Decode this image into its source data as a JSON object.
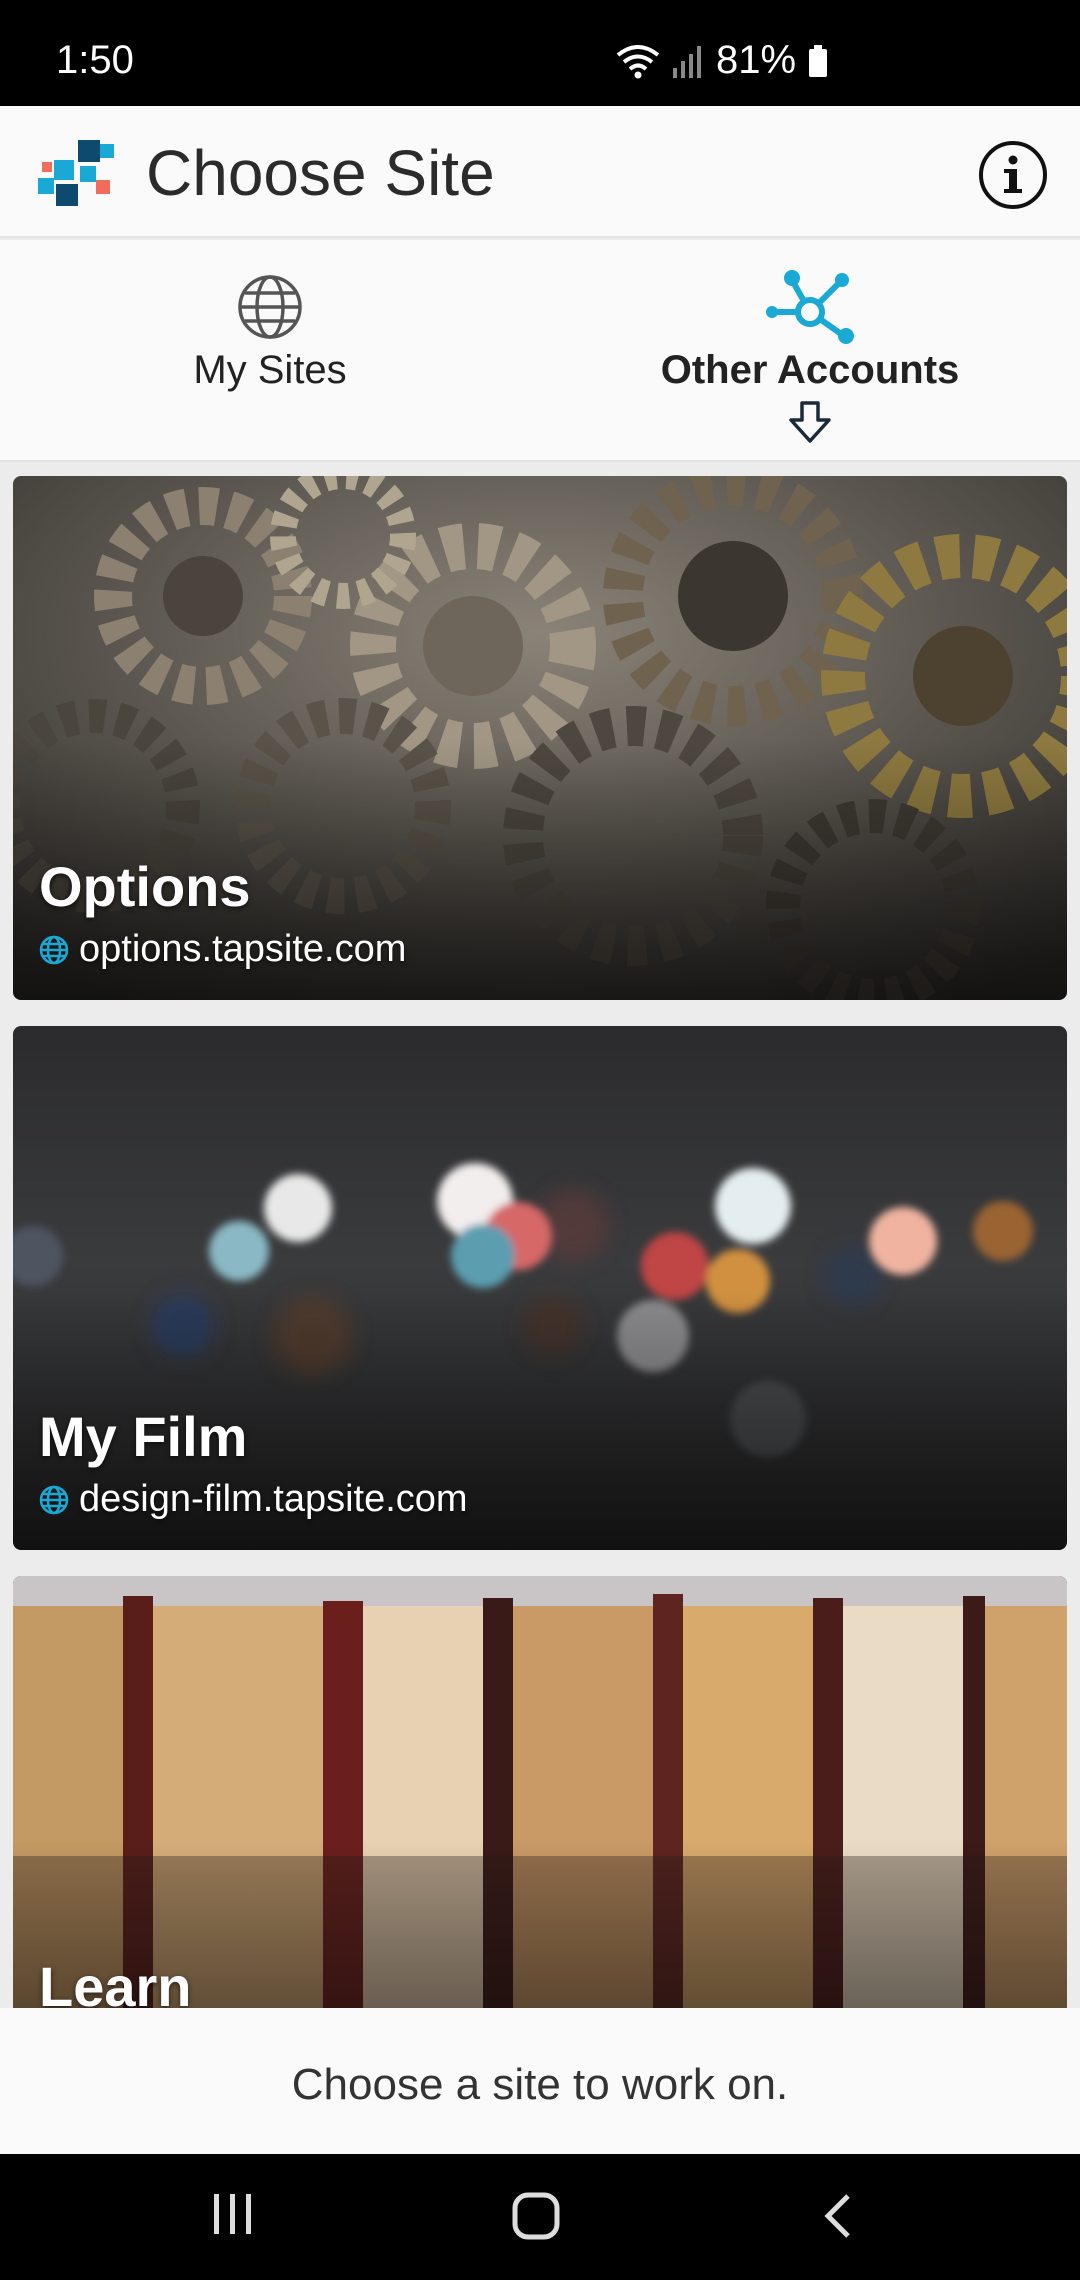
{
  "status_bar": {
    "time": "1:50",
    "battery": "81%"
  },
  "app_bar": {
    "title": "Choose Site",
    "brand_colors": [
      "#1aa8d4",
      "#0e4a6e",
      "#f26b5b"
    ]
  },
  "tabs": [
    {
      "label": "My Sites",
      "icon": "globe-icon",
      "selected": false
    },
    {
      "label": "Other Accounts",
      "icon": "network-icon",
      "selected": true
    }
  ],
  "sites": [
    {
      "title": "Options",
      "url": "options.tapsite.com",
      "image": "gears"
    },
    {
      "title": "My Film",
      "url": "design-film.tapsite.com",
      "image": "bokeh-lights"
    },
    {
      "title": "Learn",
      "url": "",
      "image": "books"
    }
  ],
  "footer": {
    "text": "Choose a site to work on."
  },
  "colors": {
    "accent": "#1aa8d4",
    "globe_icon": "#1aa8d4"
  }
}
